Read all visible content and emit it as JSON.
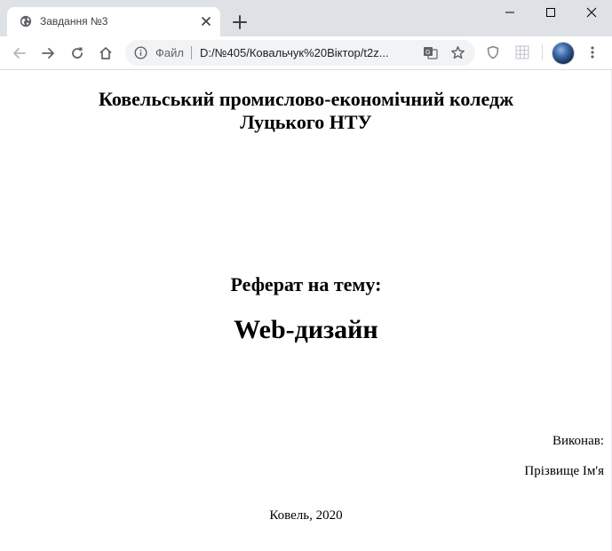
{
  "browser": {
    "tab": {
      "title": "Завдання №3"
    },
    "omnibox": {
      "scheme_label": "Файл",
      "url": "D:/№405/Ковальчук%20Віктор/t2z..."
    },
    "icons": {
      "tab_favicon": "globe-icon",
      "tab_close": "close-icon",
      "new_tab": "plus-icon",
      "back": "arrow-left-icon",
      "forward": "arrow-right-icon",
      "reload": "reload-icon",
      "home": "home-icon",
      "info": "info-icon",
      "translate": "translate-icon",
      "bookmark": "star-icon",
      "extension_1": "shield-icon",
      "extension_2": "grid-icon",
      "menu": "kebab-menu-icon",
      "minimize": "minimize-icon",
      "maximize": "maximize-icon",
      "close_window": "close-icon"
    },
    "colors": {
      "tabstrip_bg": "#dee1e6",
      "omnibox_bg": "#f1f3f4"
    }
  },
  "page": {
    "college_line1": "Ковельський промислово-економічний коледж",
    "college_line2": "Луцького НТУ",
    "ref_title": "Реферат на тему:",
    "ref_topic": "Web-дизайн",
    "author_label": "Виконав:",
    "author_name": "Прізвище Ім'я",
    "footer": "Ковель, 2020"
  }
}
